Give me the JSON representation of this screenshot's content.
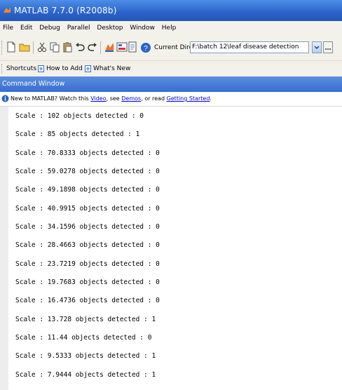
{
  "window": {
    "title": "MATLAB 7.7.0 (R2008b)"
  },
  "menu": [
    "File",
    "Edit",
    "Debug",
    "Parallel",
    "Desktop",
    "Window",
    "Help"
  ],
  "toolbar": {
    "current_directory_label": "Current Directory:",
    "current_directory_value": "F:\\batch 12\\leaf disease detection"
  },
  "shortcuts": {
    "label": "Shortcuts",
    "items": [
      "How to Add",
      "What's New"
    ]
  },
  "command_window": {
    "title": "Command Window",
    "info_prefix": "New to MATLAB? Watch this ",
    "info_link_video": "Video",
    "info_mid1": ", see ",
    "info_link_demos": "Demos",
    "info_mid2": ", or read ",
    "info_link_started": "Getting Started",
    "info_suffix": ".",
    "lines": [
      "Scale : 102 objects detected : 0",
      "Scale : 85 objects detected : 1",
      "Scale : 70.8333 objects detected : 0",
      "Scale : 59.0278 objects detected : 0",
      "Scale : 49.1898 objects detected : 0",
      "Scale : 40.9915 objects detected : 0",
      "Scale : 34.1596 objects detected : 0",
      "Scale : 28.4663 objects detected : 0",
      "Scale : 23.7219 objects detected : 0",
      "Scale : 19.7683 objects detected : 0",
      "Scale : 16.4736 objects detected : 0",
      "Scale : 13.728 objects detected : 1",
      "Scale : 11.44 objects detected : 0",
      "Scale : 9.5333 objects detected : 1",
      "Scale : 7.9444 objects detected : 1"
    ]
  },
  "colors": {
    "title_bar": "#2b63c9",
    "panel_bg": "#f2f1ea",
    "command_header": "#3a6ccf",
    "link": "#0000ee"
  }
}
